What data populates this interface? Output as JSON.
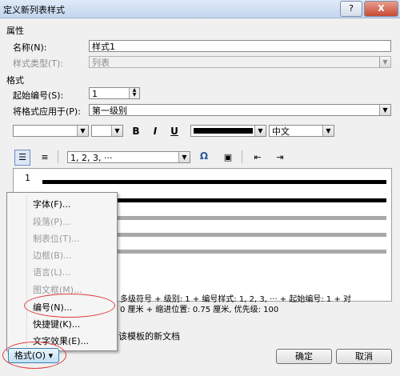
{
  "window": {
    "title": "定义新列表样式",
    "help_label": "?",
    "close_label": "X"
  },
  "properties": {
    "section": "属性",
    "name_label": "名称(N):",
    "name_value": "样式1",
    "type_label": "样式类型(T):",
    "type_value": "列表"
  },
  "format": {
    "section": "格式",
    "start_label": "起始编号(S):",
    "start_value": "1",
    "apply_label": "将格式应用于(P):",
    "apply_value": "第一级别",
    "bold_label": "B",
    "italic_label": "I",
    "underline_label": "U",
    "language_value": "中文",
    "numbering_value": "1, 2, 3, ···",
    "symbol_label": "Ω"
  },
  "preview": {
    "number": "1"
  },
  "description": {
    "line1": "多级符号 + 级别: 1 + 编号样式: 1, 2, 3, ··· + 起始编号: 1 + 对",
    "line2": "0 厘米 + 缩进位置:  0.75 厘米, 优先级: 100"
  },
  "new_doc_text": "该模板的新文档",
  "menu": {
    "items": [
      {
        "label": "字体(F)...",
        "enabled": true
      },
      {
        "label": "段落(P)...",
        "enabled": false
      },
      {
        "label": "制表位(T)...",
        "enabled": false
      },
      {
        "label": "边框(B)...",
        "enabled": false
      },
      {
        "label": "语言(L)...",
        "enabled": false
      },
      {
        "label": "图文框(M)...",
        "enabled": false
      },
      {
        "label": "编号(N)...",
        "enabled": true
      },
      {
        "label": "快捷键(K)...",
        "enabled": true
      },
      {
        "label": "文字效果(E)...",
        "enabled": true
      }
    ]
  },
  "buttons": {
    "format_label": "格式(O) ▾",
    "ok_label": "确定",
    "cancel_label": "取消"
  },
  "colors": {
    "highlight": "#e03b3b",
    "title_bg": "#c3d6ee"
  }
}
